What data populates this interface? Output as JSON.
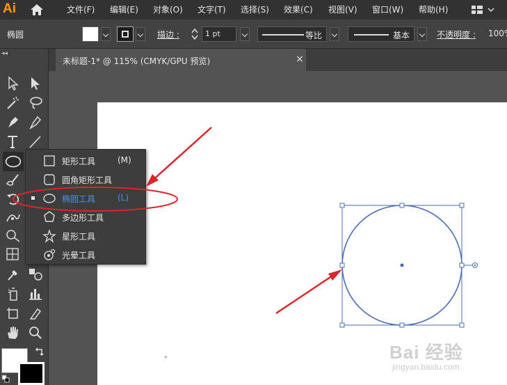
{
  "app": {
    "logo": "Ai"
  },
  "menu": {
    "items": [
      "文件(F)",
      "编辑(E)",
      "对象(O)",
      "文字(T)",
      "选择(S)",
      "效果(C)",
      "视图(V)",
      "窗口(W)",
      "帮助(H)"
    ]
  },
  "control_bar": {
    "object_label": "椭圆",
    "stroke_label": "描边 :",
    "stroke_value": "1 pt",
    "profile_label": "等比",
    "brush_label": "基本",
    "opacity_label": "不透明度 :",
    "opacity_value": "100%"
  },
  "document_tab": {
    "title": "未标题-1* @ 115% (CMYK/GPU 预览)",
    "close": "×"
  },
  "flyout": {
    "items": [
      {
        "label": "矩形工具",
        "shortcut": "(M)",
        "icon": "rectangle-icon",
        "selected": false
      },
      {
        "label": "圆角矩形工具",
        "shortcut": "",
        "icon": "rounded-rectangle-icon",
        "selected": false
      },
      {
        "label": "椭圆工具",
        "shortcut": "(L)",
        "icon": "ellipse-icon",
        "selected": true
      },
      {
        "label": "多边形工具",
        "shortcut": "",
        "icon": "polygon-icon",
        "selected": false
      },
      {
        "label": "星形工具",
        "shortcut": "",
        "icon": "star-icon",
        "selected": false
      },
      {
        "label": "光晕工具",
        "shortcut": "",
        "icon": "flare-icon",
        "selected": false
      }
    ]
  },
  "colors": {
    "selection_blue": "#4a6db5",
    "highlight_text": "#4a90e2",
    "annotation_red": "#d9262b",
    "logo_orange": "#ff9a00"
  },
  "watermark": {
    "brand": "Bai 经验",
    "url": "jingyan.baidu.com"
  }
}
